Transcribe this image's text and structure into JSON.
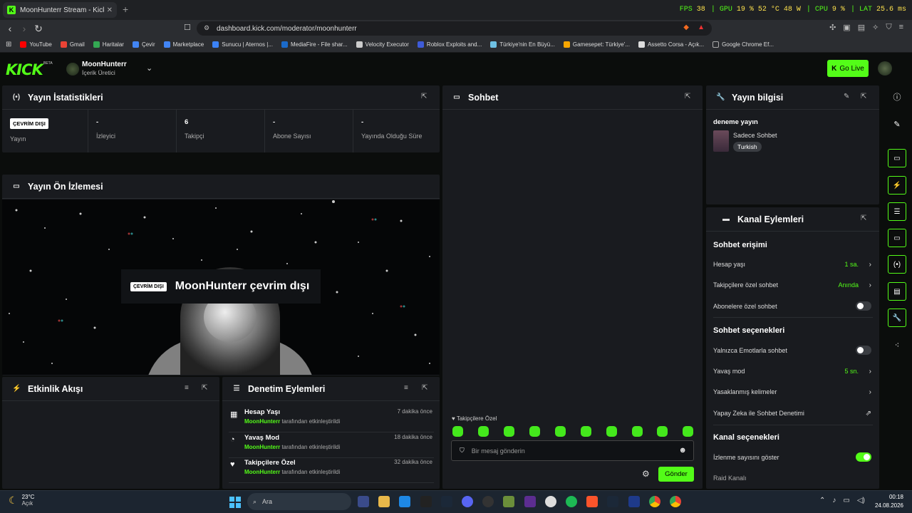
{
  "browser": {
    "tab_title": "MoonHunterr Stream - Kick Da...",
    "url": "dashboard.kick.com/moderator/moonhunterr",
    "bookmarks": [
      {
        "label": "YouTube",
        "color": "#ff0000"
      },
      {
        "label": "Gmail",
        "color": "#ea4335"
      },
      {
        "label": "Haritalar",
        "color": "#34a853"
      },
      {
        "label": "Çevir",
        "color": "#4285f4"
      },
      {
        "label": "Marketplace",
        "color": "#4285f4"
      },
      {
        "label": "Sunucu | Aternos |...",
        "color": "#3b82f6"
      },
      {
        "label": "MediaFire - File shar...",
        "color": "#1b6ac9"
      },
      {
        "label": "Velocity Executor",
        "color": "#cccccc"
      },
      {
        "label": "Roblox Exploits and...",
        "color": "#3e5bd8"
      },
      {
        "label": "Türkiye'nin En Büyü...",
        "color": "#6ec1e4"
      },
      {
        "label": "Gamesepet: Türkiye'...",
        "color": "#f7a600"
      },
      {
        "label": "Assetto Corsa - Açık...",
        "color": "#dddddd"
      },
      {
        "label": "Google Chrome Ef...",
        "color": "#888888"
      }
    ]
  },
  "hud": {
    "fps_label": "FPS",
    "fps": "38",
    "gpu_label": "GPU",
    "gpu": "19 %  52 °C  48 W",
    "cpu_label": "CPU",
    "cpu": "9 %",
    "lat_label": "LAT",
    "lat": "25.6 ms"
  },
  "header": {
    "logo": "KICK",
    "beta": "BETA",
    "channel_name": "MoonHunterr",
    "channel_role": "İçerik Üretici",
    "go_live": "Go Live"
  },
  "stats": {
    "title": "Yayın İstatistikleri",
    "badge": "ÇEVRİM DIŞI",
    "cells": [
      {
        "value": "",
        "label": "Yayın"
      },
      {
        "value": "-",
        "label": "İzleyici"
      },
      {
        "value": "6",
        "label": "Takipçi"
      },
      {
        "value": "-",
        "label": "Abone Sayısı"
      },
      {
        "value": "-",
        "label": "Yayında Olduğu Süre"
      }
    ]
  },
  "preview": {
    "title": "Yayın Ön İzlemesi",
    "badge": "ÇEVRİM DIŞI",
    "offline_text": "MoonHunterr çevrim dışı"
  },
  "activity": {
    "title": "Etkinlik Akışı"
  },
  "moderation": {
    "title": "Denetim Eylemleri",
    "items": [
      {
        "title": "Hesap Yaşı",
        "time": "7 dakika önce",
        "user": "MoonHunterr",
        "suffix": "tarafından etkinleştirildi"
      },
      {
        "title": "Yavaş Mod",
        "time": "18 dakika önce",
        "user": "MoonHunterr",
        "suffix": "tarafından etkinleştirildi"
      },
      {
        "title": "Takipçilere Özel",
        "time": "32 dakika önce",
        "user": "MoonHunterr",
        "suffix": "tarafından etkinleştirildi"
      }
    ]
  },
  "chat": {
    "title": "Sohbet",
    "mode_label": "Takipçilere Özel",
    "placeholder": "Bir mesaj gönderin",
    "send": "Gönder"
  },
  "stream_info": {
    "title": "Yayın bilgisi",
    "stream_title": "deneme yayın",
    "category": "Sadece Sohbet",
    "tag": "Turkish"
  },
  "channel_actions": {
    "title": "Kanal Eylemleri",
    "chat_access": "Sohbet erişimi",
    "account_age": {
      "label": "Hesap yaşı",
      "value": "1 sa."
    },
    "followers_only": {
      "label": "Takipçilere özel sohbet",
      "value": "Anında"
    },
    "subs_only": {
      "label": "Abonelere özel sohbet",
      "enabled": false
    },
    "chat_options": "Sohbet seçenekleri",
    "emote_only": {
      "label": "Yalnızca Emotlarla sohbet",
      "enabled": false
    },
    "slow_mode": {
      "label": "Yavaş mod",
      "value": "5 sn."
    },
    "banned_words": {
      "label": "Yasaklanmış kelimeler"
    },
    "ai_moderation": {
      "label": "Yapay Zeka ile Sohbet Denetimi"
    },
    "channel_options": "Kanal seçenekleri",
    "show_viewers": {
      "label": "İzlenme sayısını göster",
      "enabled": true
    },
    "raid": {
      "label": "Raid Kanalı"
    }
  },
  "taskbar": {
    "temp": "23°C",
    "weather": "Açık",
    "search": "Ara",
    "time": "00:18",
    "date": "24.08.2026"
  },
  "colors": {
    "accent": "#53fc18",
    "panel": "#191b1f",
    "bg": "#0b0d0c"
  }
}
